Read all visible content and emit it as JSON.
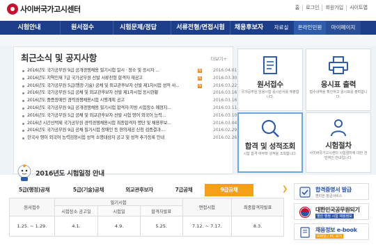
{
  "header": {
    "site_title": "사이버국가고시센터",
    "util_links": [
      "홈",
      "로그인",
      "회원가입",
      "사이트맵"
    ]
  },
  "nav": {
    "items": [
      "시험안내",
      "원서접수",
      "시험문제/정답",
      "서류전형/면접시험",
      "채용후보자"
    ],
    "sub_items": [
      "자료실",
      "온라인민원",
      "마이페이지"
    ]
  },
  "news": {
    "title": "최근소식 및 공지사항",
    "more": "더보기+",
    "items": [
      {
        "text": "2016년도 국가공무원 9급 공개경쟁채용 필기시험 일시 · 장소 및 응시자 ...",
        "date": "2016.04.01",
        "new": true
      },
      {
        "text": "2016년도 지역인재 7급 국가공무원 선발 서류전형 합격자 재공고",
        "date": "2016.03.30",
        "new": true
      },
      {
        "text": "2016년도 국가공무원 5급(행정·기술) 공채 및 외교관후보자 선발 제1차시험 성적 사...",
        "date": "2016.03.22",
        "new": true
      },
      {
        "text": "2016년도 국가공무원 5급 공채 및 외교관후보자 선발 제1차시험 응시현황",
        "date": "2016.03.16",
        "new": false
      },
      {
        "text": "2016년도 중증장애인 경력경쟁채용시험 시행계획 공고",
        "date": "2016.03.16",
        "new": false
      },
      {
        "text": "2016년도 국가공무원 9급 공개경쟁채용 필기시험 합격자·지방 시험장소 예정지...",
        "date": "2016.03.11",
        "new": false
      },
      {
        "text": "2016년도 국가공무원 5급 공채 및 외교관후보자 선발 시험 영어 외국어 능력...",
        "date": "2016.03.10",
        "new": false
      },
      {
        "text": "2016년 시간선택제 국가공무원 경력경쟁채용시험 최종합격자 명단 및 채용후보...",
        "date": "2016.03.04",
        "new": false
      },
      {
        "text": "2016년도 국가공무원 9급 공채 필기시험 장애인 등 편의제공 신청 검증결과...",
        "date": "2016.02.29",
        "new": false
      },
      {
        "text": "한국사 영어 외국어 능력검정시험 성적 소명대상자 공고 및 성적 추가등록 안내",
        "date": "2016.02.26",
        "new": false
      }
    ]
  },
  "cards": [
    {
      "title": "원서접수",
      "desc": "국가공무원 임용시험 응시원서를 제출합니다.",
      "icon": "document-icon"
    },
    {
      "title": "응시표 출력",
      "desc": "접수내역을 확인하고 응시표를 출력합니다.",
      "icon": "printer-icon"
    },
    {
      "title": "합격 및 성적조회",
      "desc": "시험 합격 여부와 성적을 조회합니다.",
      "icon": "search-icon"
    },
    {
      "title": "시험절차",
      "desc": "사이버국가고시센터 시험절차에 대한 전반적인 안내입니다.",
      "icon": "procedure-icon"
    }
  ],
  "schedule": {
    "title": "2016년도 시험일정 안내",
    "tabs": [
      "5급(행정)공채",
      "5급(기술)공채",
      "외교관후보자",
      "7급공채",
      "9급공채"
    ],
    "active_tab": 4,
    "headers": {
      "apply": "원서접수",
      "written": "필기시험",
      "interview": "면접시험",
      "final": "최종합격자발표",
      "written_sub": [
        "시험장소 공고일",
        "시험일",
        "합격자발표"
      ]
    },
    "row": {
      "apply": "1.25. ~ 1.29.",
      "notice": "4.1.",
      "exam": "4.9.",
      "pass": "5.25.",
      "interview": "7.12. ~ 7.17.",
      "final": "8.3."
    }
  },
  "side": [
    {
      "title": "합격증명서 발급",
      "sub": "편리한 발급서비스"
    },
    {
      "title": "대한민국공무원되기",
      "sub": "열린 행정 시험 채용정보"
    },
    {
      "title": "채용정보 e-book",
      "sub": "모바일 / PC 보기"
    }
  ],
  "colors": {
    "nav_bg": "#1d3f8a",
    "accent": "#f6a01a",
    "new_badge": "#f08a1c",
    "logo": "#c8102e"
  }
}
